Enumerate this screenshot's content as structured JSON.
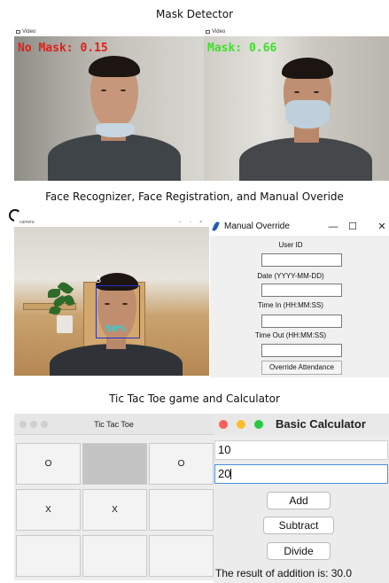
{
  "captions": {
    "mask_detector": "Mask Detector",
    "face_section": "Face Recognizer, Face Registration, and Manual  Overide",
    "games_section": "Tic Tac Toe game and Calculator"
  },
  "mask_detector": {
    "left_window": {
      "title": "Video",
      "label": "No Mask: 0.15",
      "label_color": "#e0201a"
    },
    "right_window": {
      "title": "Video",
      "label": "Mask: 0.66",
      "label_color": "#3ee02a"
    }
  },
  "camera_window": {
    "title": "camera",
    "controls": "–  ▫  ×",
    "face_id": "3",
    "confidence": "56%",
    "box_color": "#2233cc"
  },
  "manual_override": {
    "title": "Manual Override",
    "minimize": "—",
    "maximize": "☐",
    "close": "✕",
    "fields": [
      {
        "label": "User ID",
        "value": ""
      },
      {
        "label": "Date (YYYY-MM-DD)",
        "value": ""
      },
      {
        "label": "Time In (HH:MM:SS)",
        "value": ""
      },
      {
        "label": "Time Out (HH:MM:SS)",
        "value": ""
      }
    ],
    "submit_label": "Override Attendance"
  },
  "tic_tac_toe": {
    "title": "Tic Tac Toe",
    "board": [
      [
        "O",
        "",
        "O"
      ],
      [
        "X",
        "X",
        ""
      ],
      [
        "",
        "",
        ""
      ]
    ],
    "highlighted_cell": [
      0,
      1
    ]
  },
  "calculator": {
    "title": "Basic Calculator",
    "input1": "10",
    "input2": "20",
    "buttons": [
      "Add",
      "Subtract",
      "Divide"
    ],
    "result": "The result of addition is: 30.0",
    "traffic_colors": [
      "#ff5f57",
      "#febc2e",
      "#28c840"
    ]
  }
}
